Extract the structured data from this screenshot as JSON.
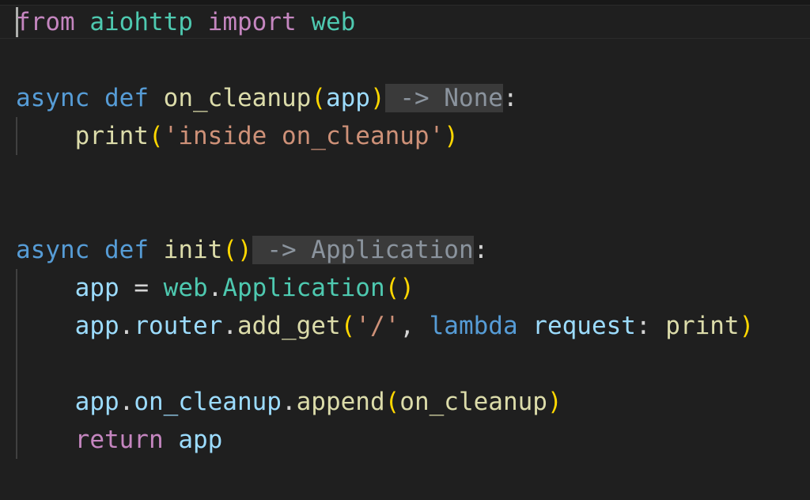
{
  "editor": {
    "language": "python",
    "colors": {
      "background": "#1f1f1f",
      "keyword_control": "#c586c0",
      "keyword_storage": "#569cd6",
      "function": "#dcdcaa",
      "variable": "#9cdcfe",
      "class": "#4ec9b0",
      "string": "#ce9178",
      "bracket": "#ffd700",
      "inlay_hint": "#8b949e"
    },
    "lines": {
      "l1": {
        "kw_from": "from",
        "module": "aiohttp",
        "kw_import": "import",
        "name": "web"
      },
      "l3": {
        "kw_async": "async",
        "kw_def": "def",
        "func": "on_cleanup",
        "open": "(",
        "param": "app",
        "close": ")",
        "hint": " -> None",
        "colon": ":"
      },
      "l4": {
        "func": "print",
        "open": "(",
        "str": "'inside on_cleanup'",
        "close": ")"
      },
      "l7": {
        "kw_async": "async",
        "kw_def": "def",
        "func": "init",
        "parens": "()",
        "hint": " -> Application",
        "colon": ":"
      },
      "l8": {
        "var": "app",
        "eq": " = ",
        "module": "web",
        "dot": ".",
        "cls": "Application",
        "parens": "()"
      },
      "l9": {
        "var": "app",
        "dot1": ".",
        "attr": "router",
        "dot2": ".",
        "method": "add_get",
        "open": "(",
        "str": "'/'",
        "comma": ", ",
        "kw_lambda": "lambda",
        "param": "request",
        "colon": ": ",
        "func": "print",
        "close": ")"
      },
      "l11": {
        "var": "app",
        "dot1": ".",
        "attr": "on_cleanup",
        "dot2": ".",
        "method": "append",
        "open": "(",
        "arg": "on_cleanup",
        "close": ")"
      },
      "l12": {
        "kw_return": "return",
        "var": "app"
      }
    }
  }
}
